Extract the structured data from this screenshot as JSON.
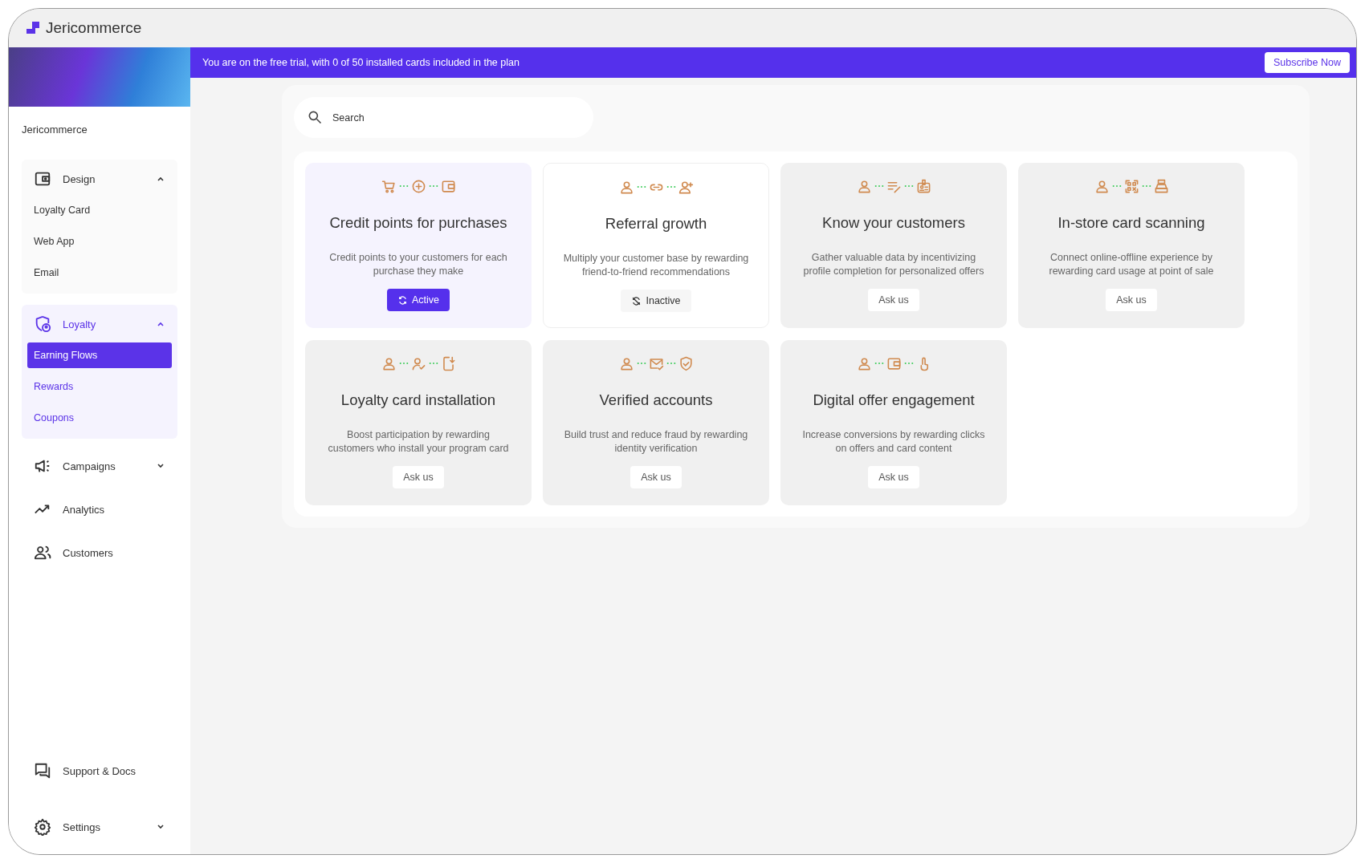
{
  "app": {
    "name": "Jericommerce"
  },
  "sidebar": {
    "workspace": "Jericommerce",
    "sections": [
      {
        "label": "Design",
        "expanded": true,
        "children": [
          {
            "label": "Loyalty Card",
            "selected": false
          },
          {
            "label": "Web App",
            "selected": false
          },
          {
            "label": "Email",
            "selected": false
          }
        ]
      },
      {
        "label": "Loyalty",
        "expanded": true,
        "children": [
          {
            "label": "Earning Flows",
            "selected": true
          },
          {
            "label": "Rewards",
            "selected": false
          },
          {
            "label": "Coupons",
            "selected": false
          }
        ]
      },
      {
        "label": "Campaigns",
        "expanded": false
      },
      {
        "label": "Analytics"
      },
      {
        "label": "Customers"
      }
    ],
    "footer": [
      {
        "label": "Support & Docs"
      },
      {
        "label": "Settings",
        "expanded": false
      }
    ]
  },
  "banner": {
    "message": "You are on the free trial, with 0 of 50 installed cards included in the plan",
    "button": "Subscribe Now"
  },
  "search": {
    "placeholder": "Search"
  },
  "cards": [
    {
      "title": "Credit points for purchases",
      "description": "Credit points to your customers for each purchase they make",
      "status": {
        "kind": "active",
        "label": "Active"
      }
    },
    {
      "title": "Referral growth",
      "description": "Multiply your customer base by rewarding friend-to-friend recommendations",
      "status": {
        "kind": "inactive",
        "label": "Inactive"
      }
    },
    {
      "title": "Know your customers",
      "description": "Gather valuable data by incentivizing profile completion for personalized offers",
      "status": {
        "kind": "ask",
        "label": "Ask us"
      }
    },
    {
      "title": "In-store card scanning",
      "description": "Connect online-offline experience by rewarding card usage at point of sale",
      "status": {
        "kind": "ask",
        "label": "Ask us"
      }
    },
    {
      "title": "Loyalty card installation",
      "description": "Boost participation by rewarding customers who install your program card",
      "status": {
        "kind": "ask",
        "label": "Ask us"
      }
    },
    {
      "title": "Verified accounts",
      "description": "Build trust and reduce fraud by rewarding identity verification",
      "status": {
        "kind": "ask",
        "label": "Ask us"
      }
    },
    {
      "title": "Digital offer engagement",
      "description": "Increase conversions by rewarding clicks on offers and card content",
      "status": {
        "kind": "ask",
        "label": "Ask us"
      }
    }
  ]
}
